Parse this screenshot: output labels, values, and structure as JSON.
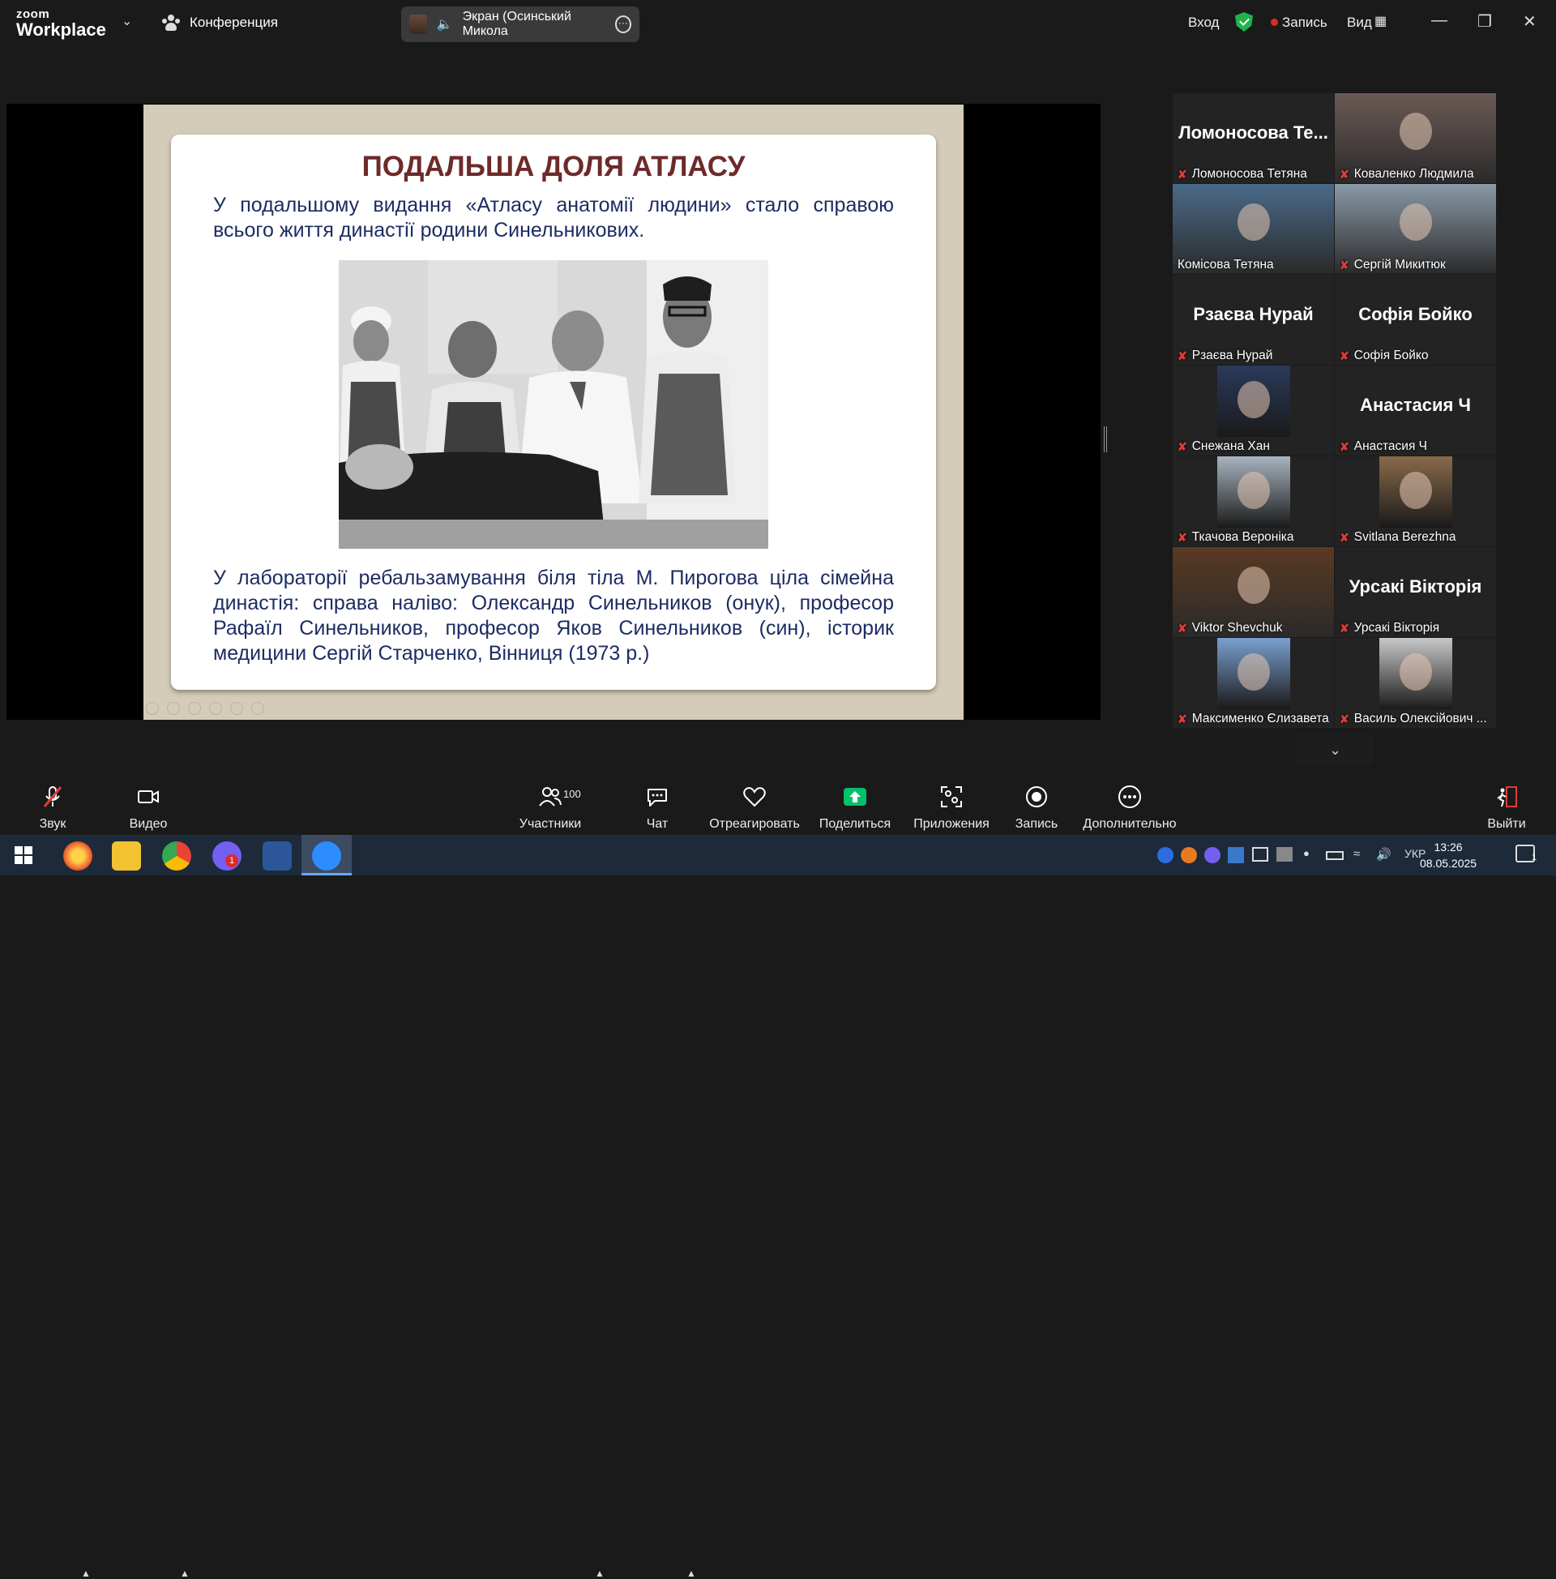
{
  "app": {
    "logo_top": "zoom",
    "logo_bottom": "Workplace",
    "conference_label": "Конференция",
    "share_label": "Экран (Осинський Микола"
  },
  "top_right": {
    "signin": "Вход",
    "record": "Запись",
    "view": "Вид"
  },
  "slide": {
    "title": "ПОДАЛЬША ДОЛЯ АТЛАСУ",
    "paragraph1": "У подальшому видання «Атласу анатомії людини» стало справою всього життя династії родини Синельникових.",
    "paragraph2": "У лабораторії ребальзамування біля тіла М. Пирогова ціла сімейна династія: справа наліво: Олександр Синельников (онук), професор Рафаїл Синельников, професор Яков Синельников (син), історик медицини Сергій Старченко, Вінниця (1973 р.)"
  },
  "participants": [
    {
      "big": "Ломоносова Те...",
      "name": "Ломоносова Тетяна",
      "video": false
    },
    {
      "big": "",
      "name": "Коваленко Людмила",
      "video": true,
      "color": "#6b5a55"
    },
    {
      "big": "",
      "name": "Комісова Тетяна",
      "video": true,
      "active": true,
      "color": "#4a6a8a"
    },
    {
      "big": "",
      "name": "Сергій Микитюк",
      "video": true,
      "color": "#8a9aa8"
    },
    {
      "big": "Рзаєва Нурай",
      "name": "Рзаєва Нурай",
      "video": false
    },
    {
      "big": "Софія Бойко",
      "name": "Софія Бойко",
      "video": false
    },
    {
      "big": "",
      "name": "Снежана Хан",
      "video": true,
      "color": "#2a3a5a",
      "thumb": true
    },
    {
      "big": "Анастасия Ч",
      "name": "Анастасия Ч",
      "video": false
    },
    {
      "big": "",
      "name": "Ткачова Вероніка",
      "video": true,
      "color": "#a8b4c0",
      "thumb": true
    },
    {
      "big": "",
      "name": "Svitlana Berezhna",
      "video": true,
      "color": "#8a6a4a",
      "thumb": true
    },
    {
      "big": "",
      "name": "Viktor Shevchuk",
      "video": true,
      "color": "#5a3a22"
    },
    {
      "big": "Урсакі Вікторія",
      "name": "Урсакі Вікторія",
      "video": false
    },
    {
      "big": "",
      "name": "Максименко Єлизавета",
      "video": true,
      "color": "#7aa0d0",
      "thumb": true
    },
    {
      "big": "",
      "name": "Василь Олексійович ...",
      "video": true,
      "color": "#c8c8c8",
      "thumb": true
    }
  ],
  "toolbar": {
    "audio": "Звук",
    "video": "Видео",
    "participants": "Участники",
    "participants_count": "100",
    "chat": "Чат",
    "react": "Отреагировать",
    "share": "Поделиться",
    "apps": "Приложения",
    "record": "Запись",
    "more": "Дополнительно",
    "leave": "Выйти"
  },
  "taskbar": {
    "lang": "УКР",
    "time": "13:26",
    "date": "08.05.2025",
    "notif_count": "1",
    "viber_badge": "1"
  },
  "colors": {
    "accent_green": "#23d96e",
    "share_green": "#00c06a",
    "title_color": "#6e2a2a",
    "text_color": "#1d2c63"
  }
}
